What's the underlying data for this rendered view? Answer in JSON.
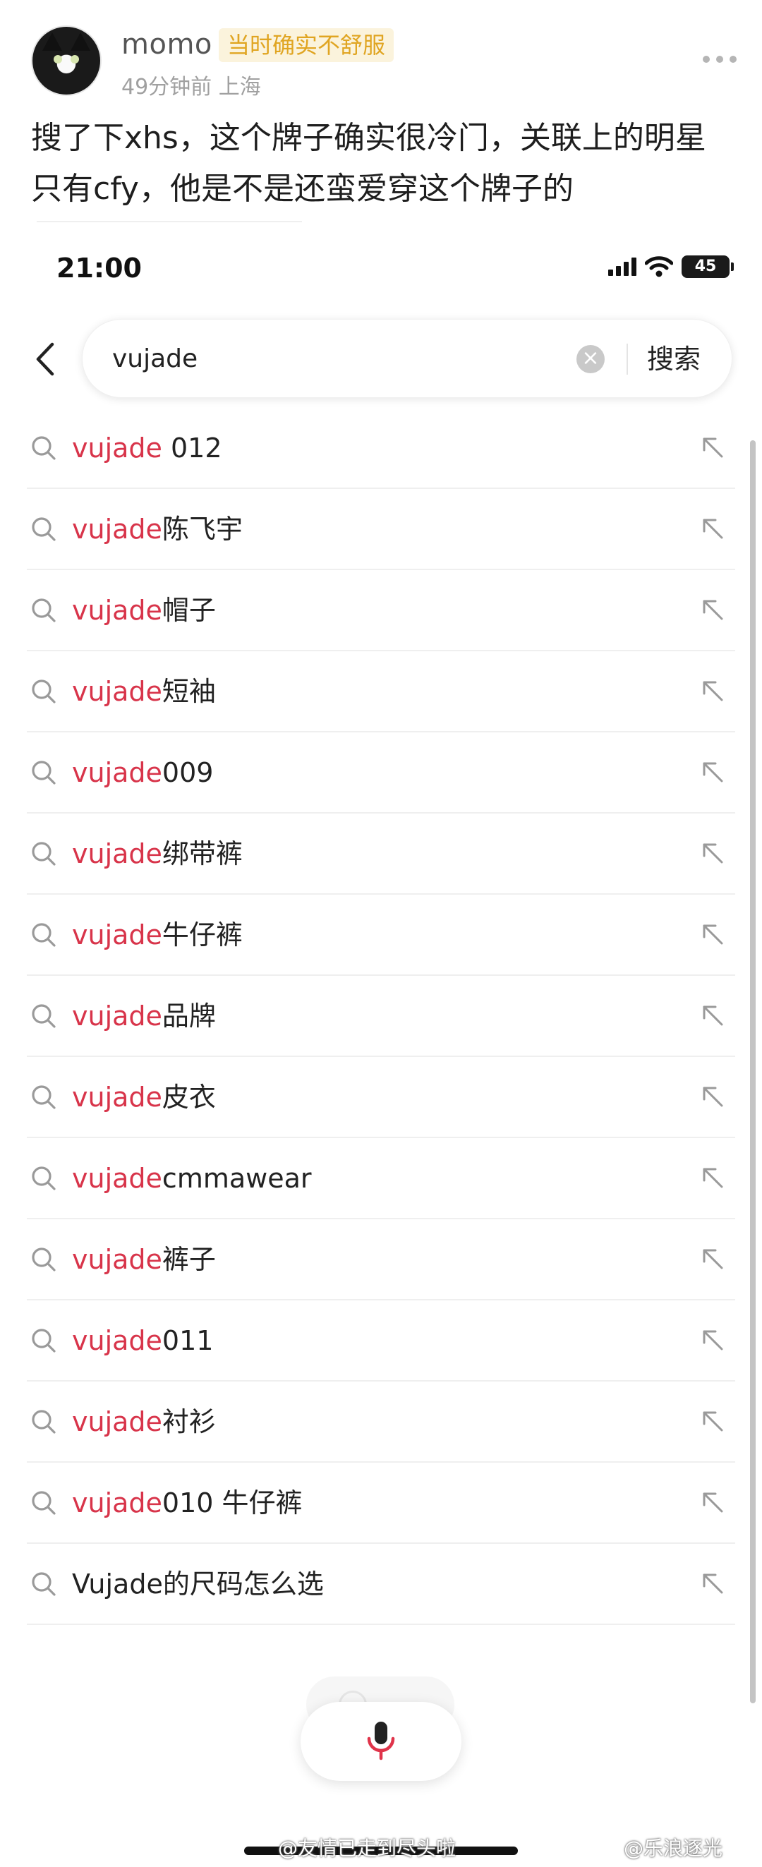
{
  "post": {
    "username": "momo",
    "badge": "当时确实不舒服",
    "meta": "49分钟前 上海",
    "text": "搜了下xhs，这个牌子确实很冷门，关联上的明星只有cfy，他是不是还蛮爱穿这个牌子的"
  },
  "phone": {
    "status_time": "21:00",
    "battery": "45",
    "search": {
      "value": "vujade",
      "button_label": "搜索"
    },
    "suggestions": [
      {
        "highlight": "vujade",
        "rest": " 012"
      },
      {
        "highlight": "vujade",
        "rest": "陈飞宇"
      },
      {
        "highlight": "vujade",
        "rest": "帽子"
      },
      {
        "highlight": "vujade",
        "rest": "短袖"
      },
      {
        "highlight": "vujade",
        "rest": "009"
      },
      {
        "highlight": "vujade",
        "rest": "绑带裤"
      },
      {
        "highlight": "vujade",
        "rest": "牛仔裤"
      },
      {
        "highlight": "vujade",
        "rest": "品牌"
      },
      {
        "highlight": "vujade",
        "rest": "皮衣"
      },
      {
        "highlight": "vujade",
        "rest": "cmmawear"
      },
      {
        "highlight": "vujade",
        "rest": "裤子"
      },
      {
        "highlight": "vujade",
        "rest": "011"
      },
      {
        "highlight": "vujade",
        "rest": "衬衫"
      },
      {
        "highlight": "vujade",
        "rest": "010 牛仔裤"
      },
      {
        "highlight": "",
        "rest": "Vujade的尺码怎么选"
      }
    ]
  },
  "watermarks": {
    "left": "@友情已走到尽头啦",
    "right": "@乐浪逐光"
  },
  "colors": {
    "highlight": "#d8344a",
    "badge_text": "#e0a522",
    "mic": "#e0344a"
  },
  "icons": {
    "more": "more-dots-icon",
    "back": "chevron-left-icon",
    "clear": "clear-circle-icon",
    "suggestion": "search-icon",
    "fill": "arrow-up-left-icon",
    "mic": "microphone-icon"
  }
}
